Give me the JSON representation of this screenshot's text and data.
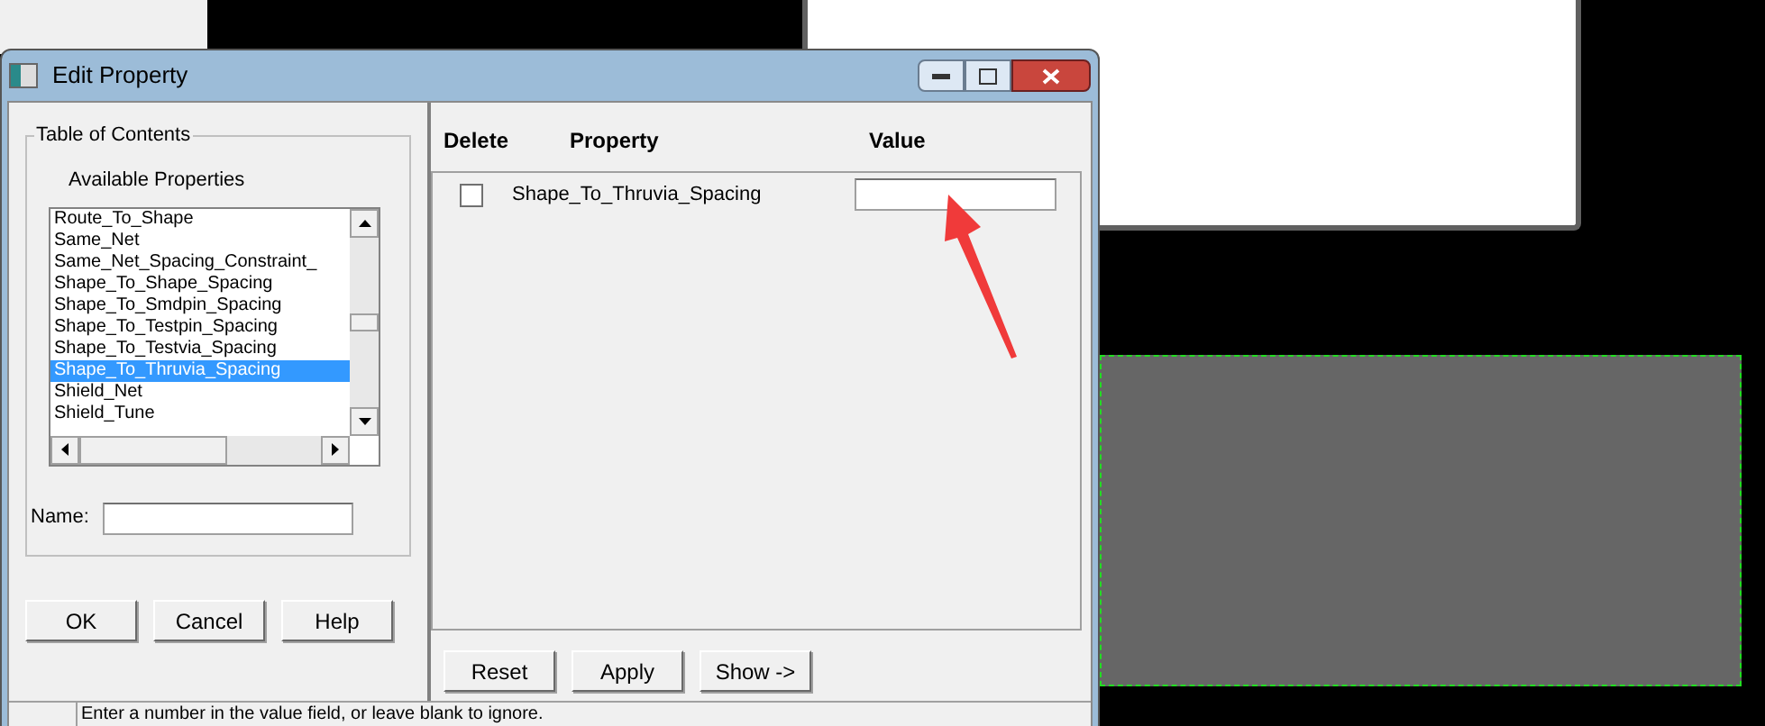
{
  "window": {
    "title": "Edit Property"
  },
  "table_of_contents": {
    "title": "Table of Contents",
    "list_label": "Available Properties",
    "items": [
      {
        "label": "Route_To_Shape",
        "selected": false
      },
      {
        "label": "Same_Net",
        "selected": false
      },
      {
        "label": "Same_Net_Spacing_Constraint_",
        "selected": false
      },
      {
        "label": "Shape_To_Shape_Spacing",
        "selected": false
      },
      {
        "label": "Shape_To_Smdpin_Spacing",
        "selected": false
      },
      {
        "label": "Shape_To_Testpin_Spacing",
        "selected": false
      },
      {
        "label": "Shape_To_Testvia_Spacing",
        "selected": false
      },
      {
        "label": "Shape_To_Thruvia_Spacing",
        "selected": true
      },
      {
        "label": "Shield_Net",
        "selected": false
      },
      {
        "label": "Shield_Tune",
        "selected": false
      }
    ],
    "name_label": "Name:"
  },
  "left_buttons": [
    "OK",
    "Cancel",
    "Help"
  ],
  "table": {
    "columns": [
      "Delete",
      "Property",
      "Value"
    ],
    "rows": [
      {
        "checked": false,
        "property": "Shape_To_Thruvia_Spacing"
      }
    ]
  },
  "right_buttons": [
    "Reset",
    "Apply",
    "Show ->"
  ],
  "status_bar": "Enter a number in the value field, or leave blank to ignore."
}
